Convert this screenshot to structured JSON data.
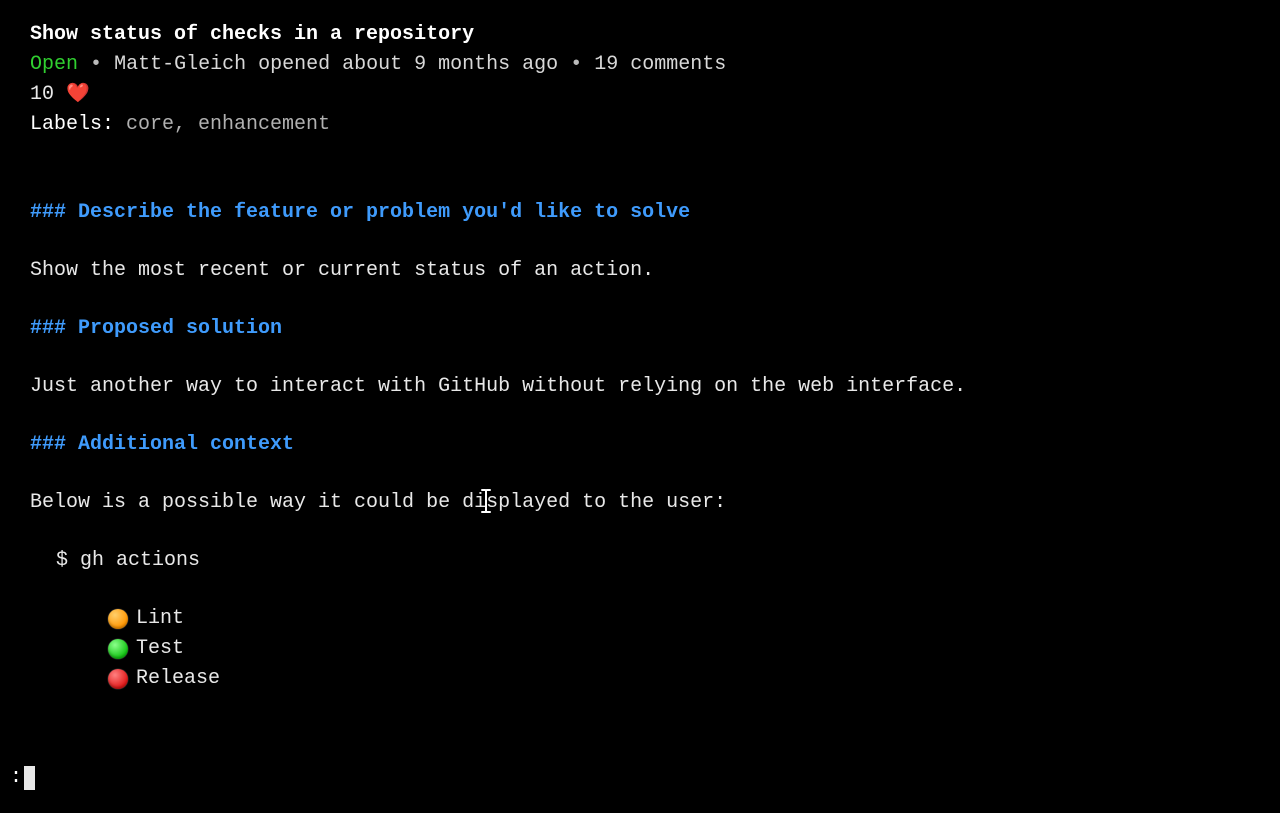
{
  "issue": {
    "title": "Show status of checks in a repository",
    "status": "Open",
    "author": "Matt-Gleich",
    "opened_relative": "about 9 months ago",
    "comments_count": "19",
    "comments_word": "comments",
    "opened_word": "opened",
    "reaction_count": "10",
    "reaction_emoji": "❤️",
    "labels_label": "Labels:",
    "labels_value": "core, enhancement",
    "bullet": "•"
  },
  "body": {
    "h1": "### Describe the feature or problem you'd like to solve",
    "p1": "Show the most recent or current status of an action.",
    "h2": "### Proposed solution",
    "p2": "Just another way to interact with GitHub without relying on the web interface.",
    "h3": "### Additional context",
    "p3": "Below is a possible way it could be displayed to the user:",
    "cmd": "$ gh actions",
    "actions": [
      {
        "color": "orange",
        "label": "Lint"
      },
      {
        "color": "green",
        "label": "Test"
      },
      {
        "color": "red",
        "label": "Release"
      }
    ]
  },
  "pager": {
    "prompt": ":"
  },
  "colors": {
    "open": "#30d030",
    "heading": "#3f9bfc",
    "orange": "#ff9500",
    "green": "#12c412",
    "red": "#e01818"
  }
}
